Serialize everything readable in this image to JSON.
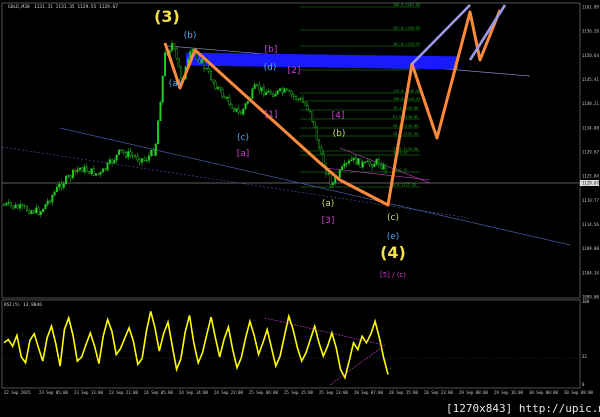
{
  "chart_data": [
    {
      "type": "candlestick",
      "header": {
        "symbol": "GOLD,M30",
        "ohlc": "1131.31 1131.35 1129.55 1129.67"
      },
      "y_ticks": [
        "1161.09",
        "1156.26",
        "1150.64",
        "1145.41",
        "1140.21",
        "1134.88",
        "1129.67",
        "1125.04",
        "1119.77",
        "1114.56",
        "1109.00",
        "1104.34",
        "1099.00"
      ],
      "current_price": "1129.67",
      "x_ticks": [
        "22 Sep 2015",
        "23 Sep 05:00",
        "23 Sep 13:00",
        "23 Sep 21:00",
        "24 Sep 05:00",
        "24 Sep 14:00",
        "24 Sep 22:00",
        "25 Sep 06:00",
        "25 Sep 15:00",
        "25 Sep 23:00",
        "28 Sep 07:00",
        "28 Sep 15:00",
        "28 Sep 23:00",
        "29 Sep 08:00",
        "29 Sep 16:00",
        "30 Sep 00:00",
        "30 Sep 08:00"
      ],
      "fib_levels": [
        "100.0 1161.03",
        "261.8 1155.82",
        "161.8 1153.57",
        "1150.47",
        "1148.28",
        "123.6 1146.50",
        "100.0 1144.93",
        "76.4 1143.06",
        "61.8 1140.89",
        "50.0 1139.05",
        "38.2 1137.20",
        "23.6 1134.08",
        "1133.67",
        "1130.21",
        "0.0 1127.35"
      ],
      "wave_labels": [
        {
          "text": "(3)",
          "color": "#f2e14c",
          "size": "large"
        },
        {
          "text": "(b)",
          "color": "#4aa8f0"
        },
        {
          "text": "(a)",
          "color": "#4aa8f0"
        },
        {
          "text": "[b]",
          "color": "#cc44cc"
        },
        {
          "text": "(d)",
          "color": "#4aa8f0"
        },
        {
          "text": "[2]",
          "color": "#cc44cc"
        },
        {
          "text": "[1]",
          "color": "#cc44cc"
        },
        {
          "text": "(c)",
          "color": "#4aa8f0"
        },
        {
          "text": "[a]",
          "color": "#cc44cc"
        },
        {
          "text": "[4]",
          "color": "#cc44cc"
        },
        {
          "text": "(b)",
          "color": "#c8dc64"
        },
        {
          "text": "(a)",
          "color": "#c8dc64"
        },
        {
          "text": "[3]",
          "color": "#cc44cc"
        },
        {
          "text": "(c)",
          "color": "#c8dc64"
        },
        {
          "text": "(e)",
          "color": "#4aa8f0"
        },
        {
          "text": "(4)",
          "color": "#f2e14c",
          "size": "large"
        },
        {
          "text": "[5] / (c)",
          "color": "#cc44cc"
        }
      ]
    },
    {
      "type": "line",
      "title": "RSI(5) 13.8846",
      "y_ticks": [
        "100",
        "32",
        "0"
      ],
      "series": [
        {
          "values": [
            52,
            56,
            48,
            61,
            35,
            28,
            55,
            63,
            46,
            30,
            58,
            72,
            51,
            24,
            68,
            82,
            61,
            30,
            35,
            50,
            64,
            48,
            27,
            60,
            80,
            66,
            38,
            45,
            58,
            70,
            54,
            26,
            33,
            66,
            90,
            70,
            42,
            63,
            77,
            48,
            20,
            33,
            65,
            85,
            52,
            28,
            40,
            62,
            83,
            58,
            35,
            56,
            71,
            44,
            22,
            34,
            58,
            78,
            61,
            38,
            52,
            68,
            46,
            24,
            36,
            60,
            84,
            68,
            46,
            30,
            40,
            56,
            72,
            52,
            36,
            48,
            64,
            46,
            20,
            10,
            30,
            52,
            44,
            60,
            52,
            62,
            78,
            58,
            34,
            14
          ]
        }
      ]
    }
  ],
  "watermark": "[1270x843] http://upic.me/",
  "colors": {
    "background": "#000000",
    "candles": "#22cc22",
    "arrow": "#ff8a3c",
    "projection": "#9a9ae8",
    "band": "#1a1aff",
    "fib": "#1a9a1a",
    "rsi": "#ffff00"
  }
}
